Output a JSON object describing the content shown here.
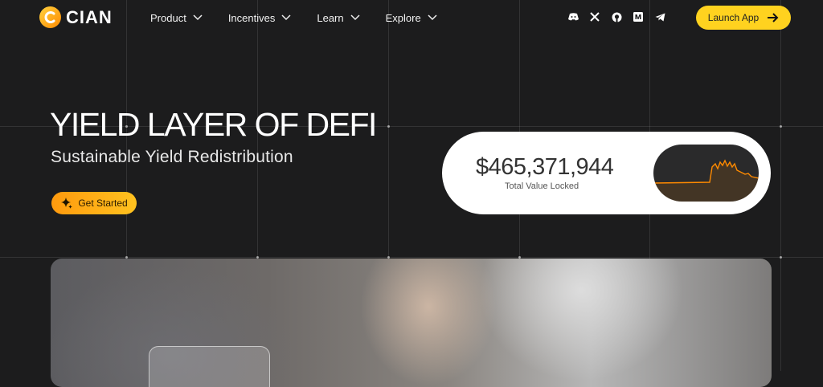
{
  "brand": {
    "name": "CIAN",
    "accent": "#ffd21f",
    "gradient_start": "#ff9a0e"
  },
  "nav": {
    "items": [
      {
        "label": "Product"
      },
      {
        "label": "Incentives"
      },
      {
        "label": "Learn"
      },
      {
        "label": "Explore"
      }
    ]
  },
  "social": [
    "discord-icon",
    "x-icon",
    "github-icon",
    "medium-icon",
    "telegram-icon"
  ],
  "header": {
    "launch_label": "Launch App"
  },
  "hero": {
    "title": "YIELD LAYER OF DEFI",
    "subtitle": "Sustainable Yield Redistribution",
    "cta_label": "Get Started"
  },
  "tvl": {
    "amount": "$465,371,944",
    "label": "Total Value Locked",
    "line_color": "#ff8a00"
  }
}
